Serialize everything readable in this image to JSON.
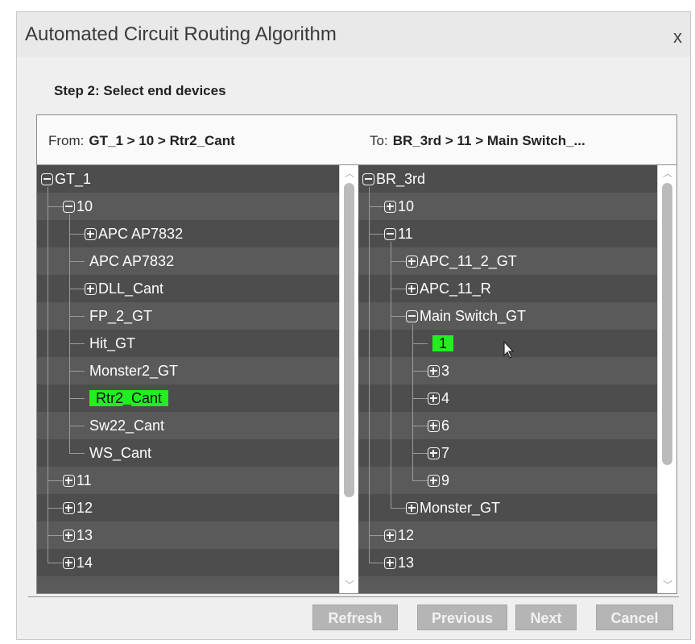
{
  "window": {
    "title": "Automated Circuit Routing Algorithm",
    "close_label": "x"
  },
  "step_label": "Step 2: Select end devices",
  "from_panel": {
    "label": "From:",
    "path": "GT_1 > 10 > Rtr2_Cant",
    "selected": "Rtr2_Cant",
    "items": [
      {
        "label": "GT_1",
        "toggle": "minus",
        "depth": 0
      },
      {
        "label": "10",
        "toggle": "minus",
        "depth": 1
      },
      {
        "label": "APC AP7832",
        "toggle": "plus",
        "depth": 2
      },
      {
        "label": "APC AP7832",
        "toggle": "none",
        "depth": 2
      },
      {
        "label": "DLL_Cant",
        "toggle": "plus",
        "depth": 2
      },
      {
        "label": "FP_2_GT",
        "toggle": "none",
        "depth": 2
      },
      {
        "label": "Hit_GT",
        "toggle": "none",
        "depth": 2
      },
      {
        "label": "Monster2_GT",
        "toggle": "none",
        "depth": 2
      },
      {
        "label": "Rtr2_Cant",
        "toggle": "none",
        "depth": 2,
        "selected": true
      },
      {
        "label": "Sw22_Cant",
        "toggle": "none",
        "depth": 2
      },
      {
        "label": "WS_Cant",
        "toggle": "none",
        "depth": 2
      },
      {
        "label": "11",
        "toggle": "plus",
        "depth": 1
      },
      {
        "label": "12",
        "toggle": "plus",
        "depth": 1
      },
      {
        "label": "13",
        "toggle": "plus",
        "depth": 1
      },
      {
        "label": "14",
        "toggle": "plus",
        "depth": 1
      }
    ]
  },
  "to_panel": {
    "label": "To:",
    "path": "BR_3rd > 11 > Main Switch_...",
    "selected": "1",
    "items": [
      {
        "label": "BR_3rd",
        "toggle": "minus",
        "depth": 0
      },
      {
        "label": "10",
        "toggle": "plus",
        "depth": 1
      },
      {
        "label": "11",
        "toggle": "minus",
        "depth": 1
      },
      {
        "label": "APC_11_2_GT",
        "toggle": "plus",
        "depth": 2
      },
      {
        "label": "APC_11_R",
        "toggle": "plus",
        "depth": 2
      },
      {
        "label": "Main Switch_GT",
        "toggle": "minus",
        "depth": 2
      },
      {
        "label": "1",
        "toggle": "none",
        "depth": 3,
        "selected": true
      },
      {
        "label": "3",
        "toggle": "plus",
        "depth": 3
      },
      {
        "label": "4",
        "toggle": "plus",
        "depth": 3
      },
      {
        "label": "6",
        "toggle": "plus",
        "depth": 3
      },
      {
        "label": "7",
        "toggle": "plus",
        "depth": 3
      },
      {
        "label": "9",
        "toggle": "plus",
        "depth": 3
      },
      {
        "label": "Monster_GT",
        "toggle": "plus",
        "depth": 2
      },
      {
        "label": "12",
        "toggle": "plus",
        "depth": 1
      },
      {
        "label": "13",
        "toggle": "plus",
        "depth": 1
      }
    ]
  },
  "buttons": {
    "refresh": "Refresh",
    "previous": "Previous",
    "next": "Next",
    "cancel": "Cancel"
  },
  "colors": {
    "tree_bg": "#4d4d4d",
    "tree_row_alt": "#5a5a5a",
    "selection": "#22ee22",
    "button_disabled": "#b5b5b5"
  }
}
